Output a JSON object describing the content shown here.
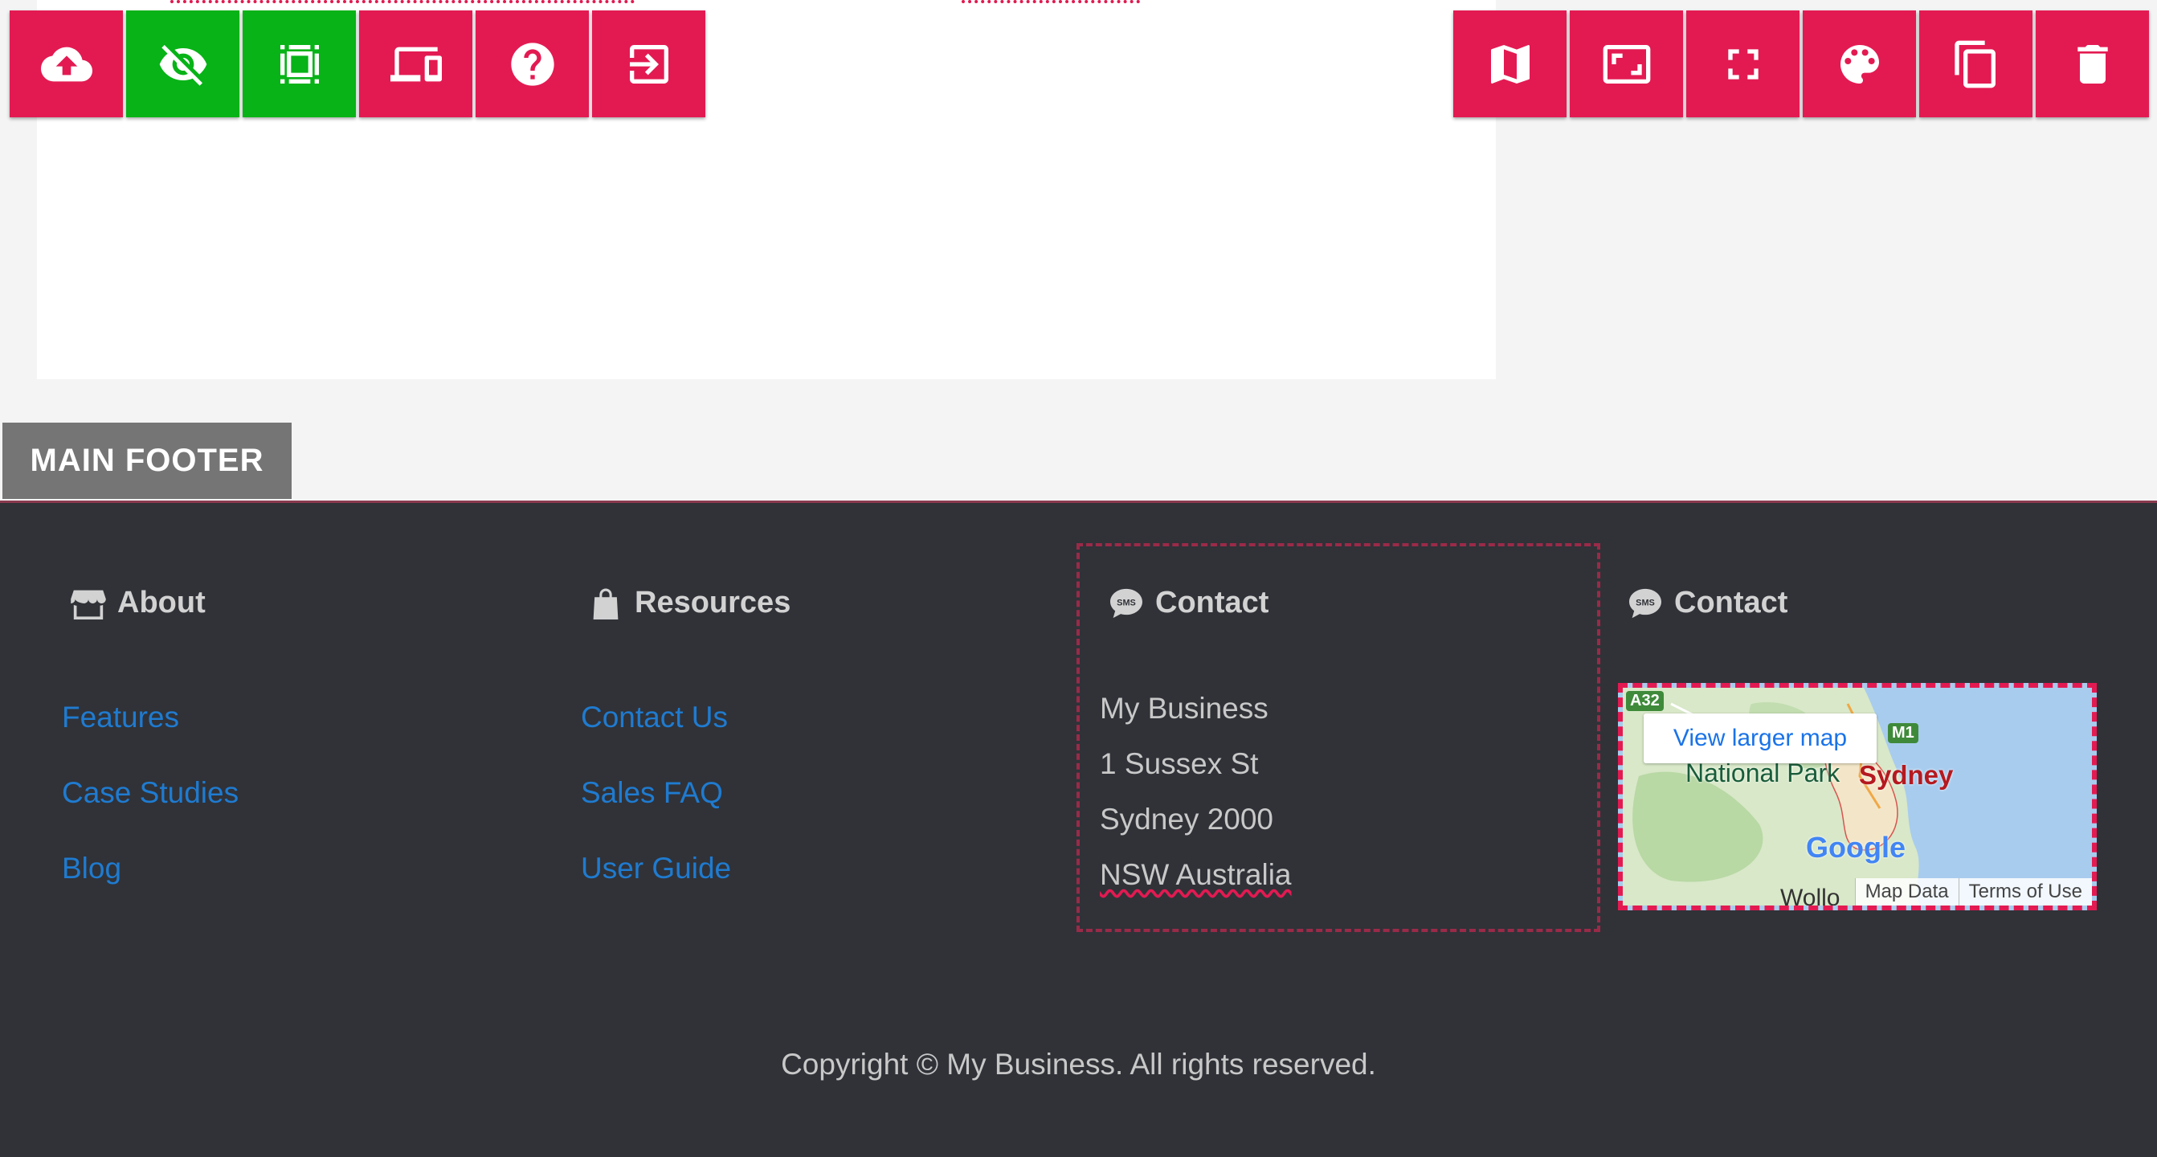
{
  "toolbar_left": [
    {
      "icon": "cloud-upload-icon",
      "color": "#e31a52"
    },
    {
      "icon": "eye-off-icon",
      "color": "#07b317"
    },
    {
      "icon": "crop-frame-icon",
      "color": "#07b317"
    },
    {
      "icon": "devices-icon",
      "color": "#e31a52"
    },
    {
      "icon": "help-icon",
      "color": "#e31a52"
    },
    {
      "icon": "exit-icon",
      "color": "#e31a52"
    }
  ],
  "toolbar_right": [
    {
      "icon": "map-icon"
    },
    {
      "icon": "aspect-ratio-icon"
    },
    {
      "icon": "fullscreen-icon"
    },
    {
      "icon": "palette-icon"
    },
    {
      "icon": "copy-icon"
    },
    {
      "icon": "trash-icon"
    }
  ],
  "section_label": "MAIN FOOTER",
  "footer": {
    "about": {
      "heading": "About",
      "links": [
        "Features",
        "Case Studies",
        "Blog"
      ]
    },
    "resources": {
      "heading": "Resources",
      "links": [
        "Contact Us",
        "Sales FAQ",
        "User Guide"
      ]
    },
    "contact": {
      "heading": "Contact",
      "address": [
        "My Business",
        "1 Sussex St",
        "Sydney 2000",
        "NSW Australia"
      ]
    },
    "contact_map": {
      "heading": "Contact",
      "map": {
        "button": "View larger map",
        "place_label": "National Park",
        "city_label": "Sydney",
        "brand": "Google",
        "partial_label": "Wollo",
        "road_a": "A32",
        "road_m": "M1",
        "map_data": "Map Data",
        "terms": "Terms of Use"
      }
    },
    "copyright": "Copyright © My Business. All rights reserved."
  },
  "colors": {
    "accent": "#e31a52",
    "active": "#07b317",
    "footer_bg": "#303238",
    "link": "#1f7bd0"
  }
}
